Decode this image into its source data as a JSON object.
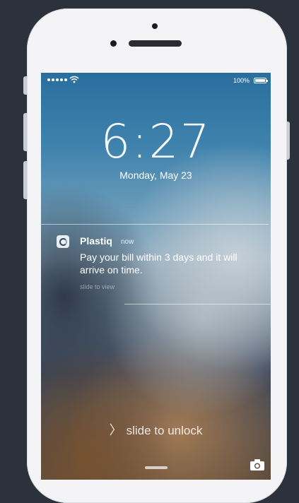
{
  "status_bar": {
    "battery": "100%"
  },
  "lock_screen": {
    "time": "6:27",
    "date": "Monday, May 23",
    "unlock_text": "slide to unlock"
  },
  "notification": {
    "app_name": "Plastiq",
    "time": "now",
    "message": "Pay your bill within 3 days and it will arrive on time.",
    "hint": "slide to view"
  },
  "icons": {
    "wifi": "wifi-icon",
    "battery": "battery-icon",
    "app": "plastiq-app-icon",
    "camera": "camera-icon",
    "chevron": "chevron-right-icon"
  }
}
